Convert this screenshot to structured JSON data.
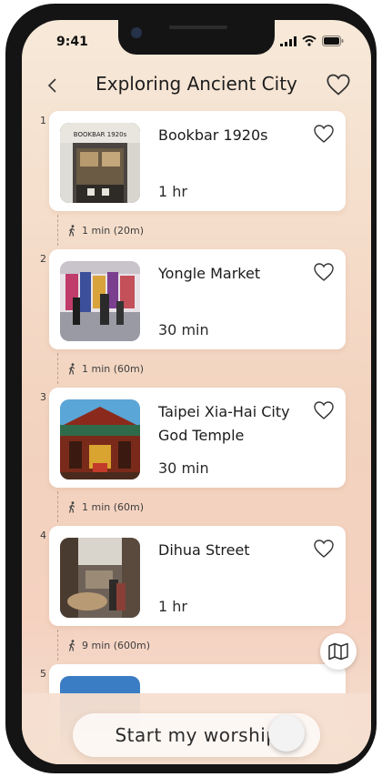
{
  "status_bar": {
    "time": "9:41"
  },
  "header": {
    "title": "Exploring Ancient City",
    "back_icon": "chevron-left-icon",
    "favorite_icon": "heart-outline-icon"
  },
  "stops": [
    {
      "index": "1",
      "name": "Bookbar 1920s",
      "duration": "1 hr",
      "image_sign": "BOOKBAR 1920s"
    },
    {
      "index": "2",
      "name": "Yongle Market",
      "duration": "30 min"
    },
    {
      "index": "3",
      "name": "Taipei Xia-Hai City God Temple",
      "duration": "30 min"
    },
    {
      "index": "4",
      "name": "Dihua Street",
      "duration": "1 hr"
    },
    {
      "index": "5",
      "name": "",
      "duration": ""
    }
  ],
  "walks": [
    {
      "text": "1 min (20m)"
    },
    {
      "text": "1 min (60m)"
    },
    {
      "text": "1 min (60m)"
    },
    {
      "text": "9 min (600m)"
    }
  ],
  "footer": {
    "start_label": "Start  my worship"
  },
  "colors": {
    "accent_bg": "#f4dac7",
    "card": "#ffffff",
    "text": "#1d1d1d"
  }
}
